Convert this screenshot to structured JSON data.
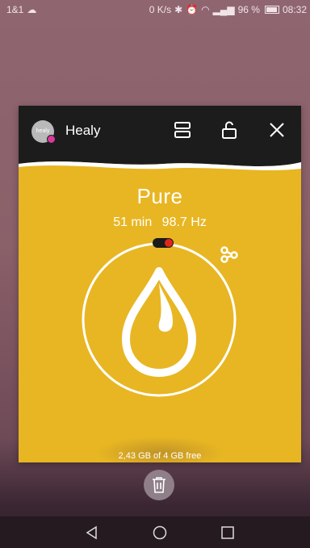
{
  "status_bar": {
    "carrier": "1&1",
    "speed": "0 K/s",
    "battery_percent": "96 %",
    "battery_level": 0.96,
    "time": "08:32",
    "icons": [
      "cloud-icon",
      "bluetooth-icon",
      "alarm-icon",
      "wifi-icon",
      "signal-icon",
      "battery-icon"
    ]
  },
  "app_card": {
    "header": {
      "logo_text": "healy",
      "title": "Healy",
      "icons": [
        "split-screen-icon",
        "unlock-icon",
        "close-icon"
      ]
    },
    "program": {
      "name": "Pure",
      "duration": "51 min",
      "frequency": "98.7 Hz"
    },
    "colors": {
      "card_background": "#e8b623",
      "header_background": "#1c1c1c",
      "toggle_indicator": "#e0251f"
    }
  },
  "recents": {
    "storage_info": "2,43 GB of 4 GB free"
  },
  "nav": {
    "buttons": [
      "back-icon",
      "home-icon",
      "recents-icon"
    ]
  }
}
